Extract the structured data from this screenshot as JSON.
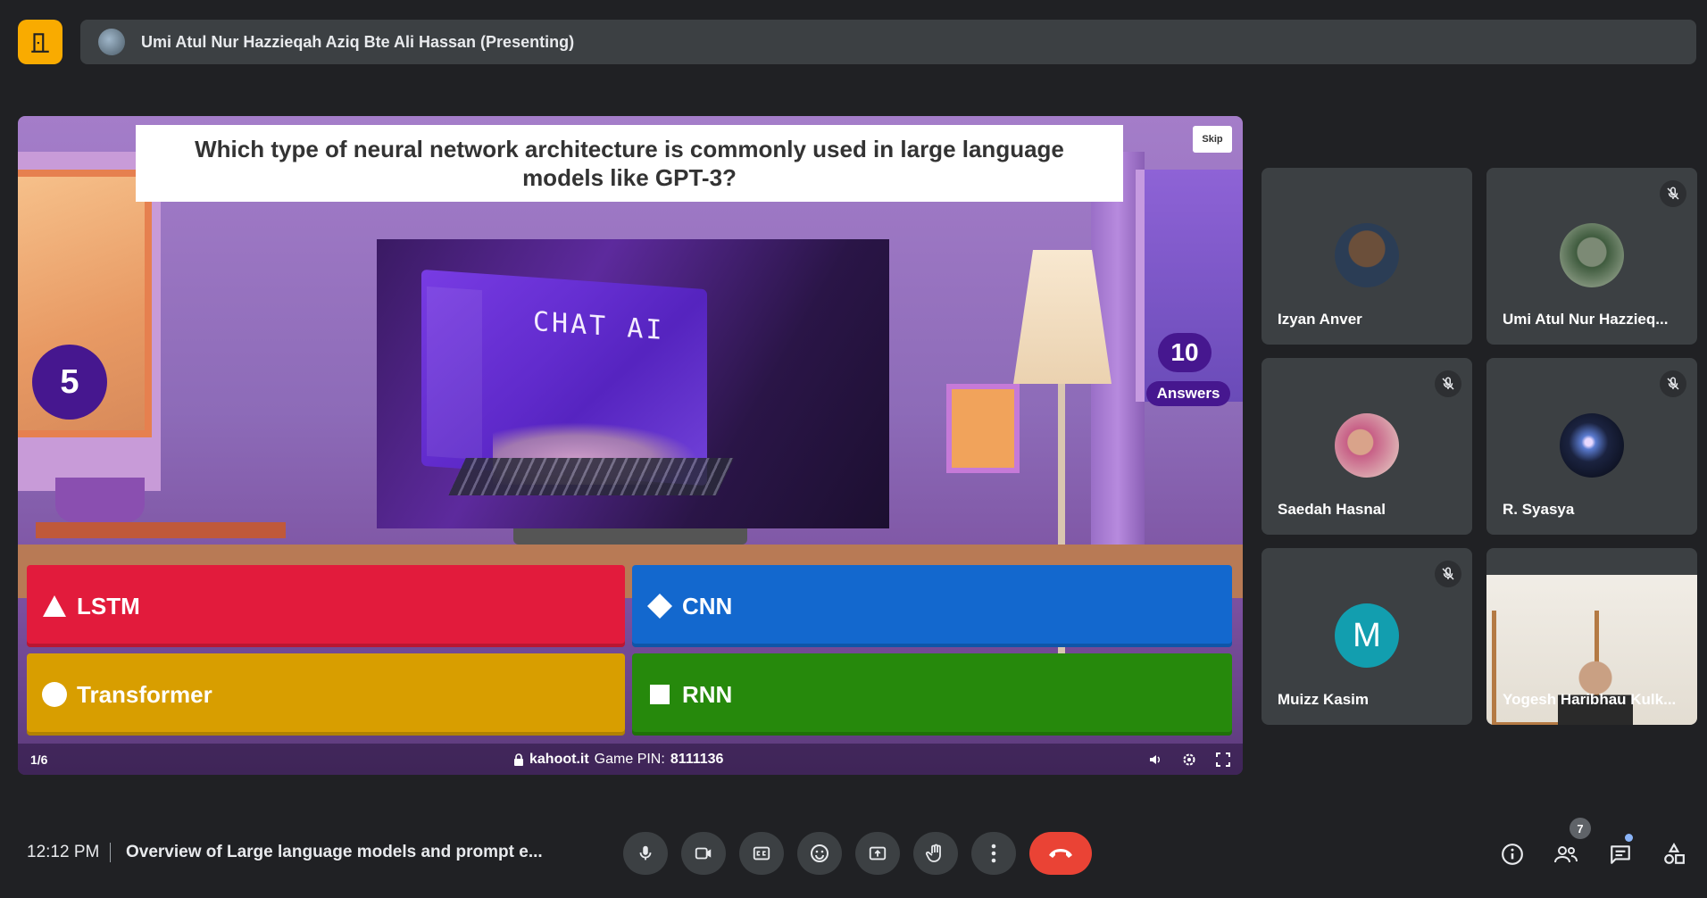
{
  "presenter_bar": {
    "label": "Umi Atul Nur Hazzieqah Aziq Bte Ali Hassan (Presenting)"
  },
  "kahoot": {
    "question": "Which type of neural network architecture is commonly used in large language models like GPT-3?",
    "skip_label": "Skip",
    "timer": "5",
    "answers_count": "10",
    "answers_label": "Answers",
    "media_text": "CHAT AI",
    "options": [
      {
        "shape": "triangle-icon",
        "label": "LSTM",
        "color": "#e21b3c"
      },
      {
        "shape": "diamond-icon",
        "label": "CNN",
        "color": "#1368ce"
      },
      {
        "shape": "circle-icon",
        "label": "Transformer",
        "color": "#d89e00"
      },
      {
        "shape": "square-icon",
        "label": "RNN",
        "color": "#26890c"
      }
    ],
    "footer": {
      "progress": "1/6",
      "site": "kahoot.it",
      "pin_label": "Game PIN:",
      "pin": "8111136"
    }
  },
  "participants": [
    {
      "name": "Izyan Anver",
      "muted": false
    },
    {
      "name": "Umi Atul Nur Hazzieq...",
      "muted": true
    },
    {
      "name": "Saedah Hasnal",
      "muted": true
    },
    {
      "name": "R. Syasya",
      "muted": true
    },
    {
      "name": "Muizz Kasim",
      "muted": true,
      "initial": "M"
    },
    {
      "name": "Yogesh Haribhau Kulk...",
      "muted": false,
      "video": true
    }
  ],
  "bottom_bar": {
    "time": "12:12 PM",
    "meeting_title": "Overview of Large language models and prompt e...",
    "people_count": "7"
  },
  "colors": {
    "background": "#202124",
    "tile": "#3c4043",
    "kahoot_purple": "#46178f",
    "leave_red": "#ea4335",
    "exit_yellow": "#f9ab00"
  }
}
